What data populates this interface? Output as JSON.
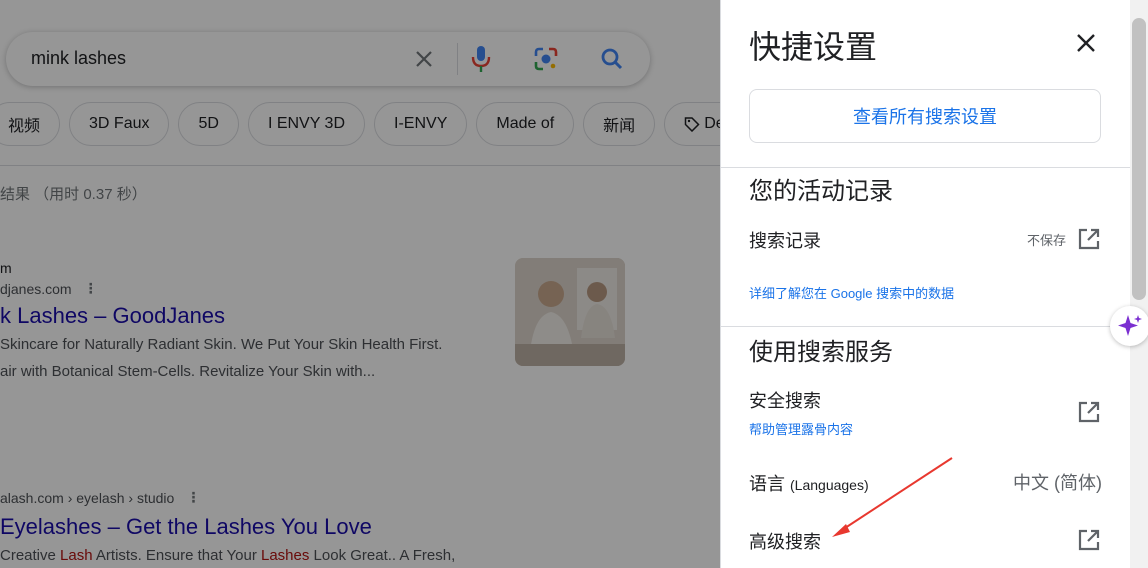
{
  "search": {
    "query": "mink lashes",
    "chips": [
      "视频",
      "3D Faux",
      "5D",
      "I ENVY 3D",
      "I-ENVY",
      "Made of",
      "新闻",
      "Deals"
    ],
    "stats": "结果 （用时 0.37 秒）"
  },
  "results": [
    {
      "site": "m",
      "url": "djanes.com",
      "title": "k Lashes – GoodJanes",
      "snippet1": "Skincare for Naturally Radiant Skin. We Put Your Skin Health First.",
      "snippet2": "air with Botanical Stem-Cells. Revitalize Your Skin with..."
    },
    {
      "url": "alash.com › eyelash › studio",
      "title": "Eyelashes – Get the Lashes You Love",
      "snippet_a": "Creative ",
      "snippet_b": "Lash",
      "snippet_c": " Artists. Ensure that Your ",
      "snippet_d": "Lashes",
      "snippet_e": " Look Great.. A Fresh,"
    }
  ],
  "panel": {
    "title": "快捷设置",
    "all_settings_button": "查看所有搜索设置",
    "activity": {
      "heading": "您的活动记录",
      "history_label": "搜索记录",
      "history_status": "不保存",
      "learn_more": "详细了解您在 Google 搜索中的数据"
    },
    "services": {
      "heading": "使用搜索服务",
      "safesearch_label": "安全搜索",
      "safesearch_sub": "帮助管理露骨内容",
      "language_label": "语言",
      "language_label_en": "(Languages)",
      "language_value": "中文 (简体)",
      "advanced_label": "高级搜索"
    }
  },
  "colors": {
    "link_blue": "#1a73e8",
    "result_title": "#1a0dab",
    "annotation_red": "#e8382f"
  }
}
